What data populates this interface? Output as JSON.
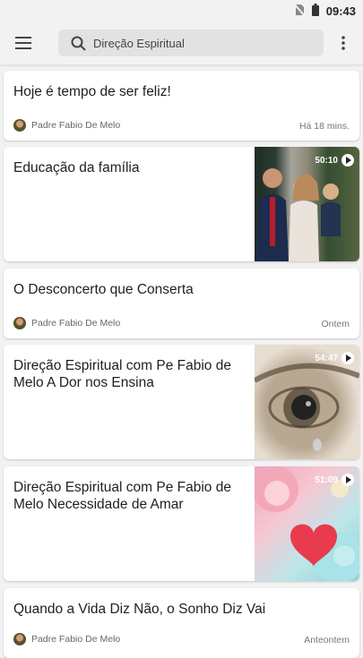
{
  "status": {
    "time": "09:43"
  },
  "search": {
    "text": "Direção Espiritual"
  },
  "feed": {
    "c1": {
      "title": "Hoje é tempo de ser feliz!",
      "author": "Padre Fabio De Melo",
      "when": "Há 18 mins."
    },
    "c2": {
      "title": "Educação da família",
      "duration": "50:10"
    },
    "c3": {
      "title": "O Desconcerto que Conserta",
      "author": "Padre Fabio De Melo",
      "when": "Ontem"
    },
    "c4": {
      "title": "Direção Espiritual com Pe Fabio de Melo A Dor nos Ensina",
      "duration": "54:47"
    },
    "c5": {
      "title": "Direção Espiritual com Pe Fabio de Melo Necessidade de Amar",
      "duration": "51:09"
    },
    "c6": {
      "title": "Quando a Vida Diz Não, o Sonho Diz Vai",
      "author": "Padre Fabio De Melo",
      "when": "Anteontem"
    }
  }
}
